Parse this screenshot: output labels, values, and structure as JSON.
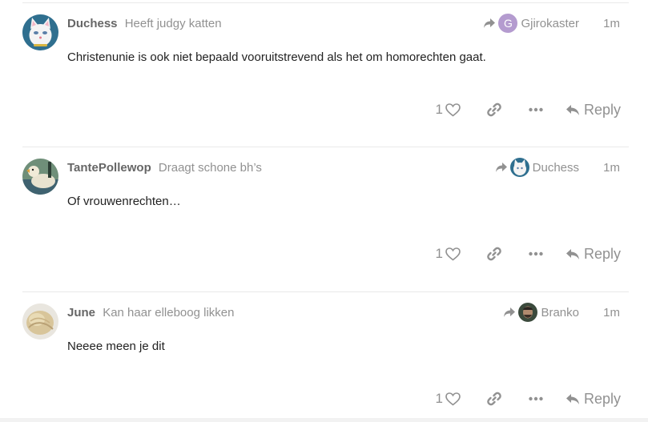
{
  "posts": [
    {
      "username": "Duchess",
      "user_title": "Heeft judgy katten",
      "reply_to": {
        "name": "Gjirokaster",
        "avatar_letter": "G"
      },
      "time": "1m",
      "content": "Christenunie is ook niet bepaald vooruitstrevend als het om homorechten gaat.",
      "likes": "1",
      "reply_label": "Reply"
    },
    {
      "username": "TantePollewop",
      "user_title": "Draagt schone bh’s",
      "reply_to": {
        "name": "Duchess"
      },
      "time": "1m",
      "content": "Of vrouwenrechten…",
      "likes": "1",
      "reply_label": "Reply"
    },
    {
      "username": "June",
      "user_title": "Kan haar elleboog likken",
      "reply_to": {
        "name": "Branko"
      },
      "time": "1m",
      "content": "Neeee meen je dit",
      "likes": "1",
      "reply_label": "Reply"
    }
  ],
  "icons": {
    "like": "heart-icon",
    "share": "link-icon",
    "more": "ellipsis-icon",
    "reply": "reply-icon",
    "reply_to": "share-arrow-icon"
  },
  "colors": {
    "muted": "#919191",
    "username": "#666666",
    "text": "#222222",
    "divider": "#e9e9e9",
    "letter_avatar": "#b49bcf"
  }
}
